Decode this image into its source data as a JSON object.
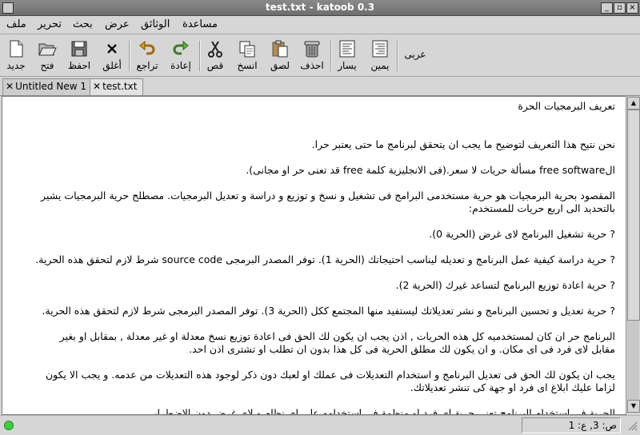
{
  "window": {
    "title": "test.txt - katoob 0.3"
  },
  "menu": [
    "ملف",
    "تحرير",
    "بحث",
    "عرض",
    "الوثائق",
    "مساعدة"
  ],
  "toolbar": {
    "new": "جديد",
    "open": "فتح",
    "save": "احفظ",
    "close": "أغلق",
    "undo": "تراجع",
    "redo": "إعادة",
    "cut": "قص",
    "copy": "انسخ",
    "paste": "لصق",
    "delete": "احذف",
    "left": "يسار",
    "right": "يمين",
    "encoding": "عربى"
  },
  "tabs": [
    "Untitled New 1",
    "test.txt"
  ],
  "document": {
    "lines": [
      "تعريف البرمجيات الحرة",
      "نحن نتيح هذا التعريف لتوضيح ما يجب ان يتحقق لبرنامج ما حتى يعتبر حرا.",
      "الfree software مسألة حريات لا سعر.(فى الانجليزية كلمة free قد تعنى حر او مجانى).",
      "المقصود بحرية البرمجيات هو حرية مستخدمى البرامج فى تشغيل و نسخ و توزيع و دراسة و تعديل البرمجيات. مصطلح حرية البرمجيات يشير",
      "بالتحديد الى اربع حريات للمستخدم:",
      "? حرية تشغيل البرنامج لاى غرض (الحرية 0).",
      "? حرية دراسة كيفية عمل البرنامج و تعديله ليناسب احتيجاتك (الحرية 1). توفر المصدر البرمجى source code شرط لازم لتحقق هذه الحرية.",
      "? حرية اعادة توزيع البرنامج لتساعد غيرك (الحرية 2).",
      "? حرية تعديل و تحسين البرنامج و نشر تعديلاتك ليستفيد منها المجتمع ككل (الحرية 3). توفر المصدر البرمجى شرط لازم لتحقق هذه الحرية.",
      "البرنامج حر ان كان لمستخدميه كل هذه الحريات , اذن يجب ان يكون لك الحق فى اعادة توزيع نسخ معدلة او غير معدلة , بمقابل او بغير",
      "مقابل لاى فرد فى اى مكان. و ان يكون لك مطلق الحرية فى كل هذا بدون ان تطلب او تشترى اذن احد.",
      "يجب ان يكون لك الحق فى تعديل البرنامج و استخدام التعديلات فى عملك او لعبك دون ذكر لوجود هذه التعديلات من عدمه. و يجب الا يكون",
      "لزاما عليك ابلاغ اى فرد او جهة كى تنشر تعديلاتك.",
      "الحرية فى استخدام البرنامج تعنى حرية اى فرد او منظمة فى استخدامه على اى نظام و لاى غرض دون الاضطرار"
    ]
  },
  "status": {
    "position": "ص: 3, ع: 1"
  }
}
